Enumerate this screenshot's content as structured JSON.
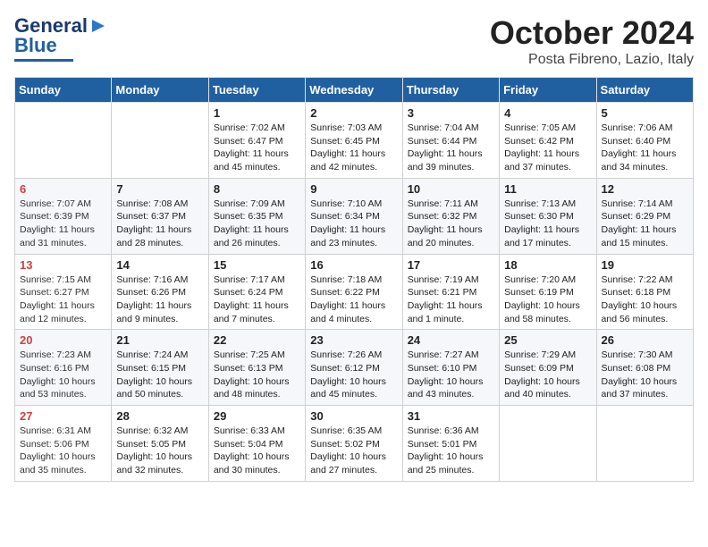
{
  "header": {
    "logo_line1": "General",
    "logo_line2": "Blue",
    "title": "October 2024",
    "subtitle": "Posta Fibreno, Lazio, Italy"
  },
  "days_of_week": [
    "Sunday",
    "Monday",
    "Tuesday",
    "Wednesday",
    "Thursday",
    "Friday",
    "Saturday"
  ],
  "weeks": [
    [
      {
        "day": "",
        "info": ""
      },
      {
        "day": "",
        "info": ""
      },
      {
        "day": "1",
        "info": "Sunrise: 7:02 AM\nSunset: 6:47 PM\nDaylight: 11 hours and 45 minutes."
      },
      {
        "day": "2",
        "info": "Sunrise: 7:03 AM\nSunset: 6:45 PM\nDaylight: 11 hours and 42 minutes."
      },
      {
        "day": "3",
        "info": "Sunrise: 7:04 AM\nSunset: 6:44 PM\nDaylight: 11 hours and 39 minutes."
      },
      {
        "day": "4",
        "info": "Sunrise: 7:05 AM\nSunset: 6:42 PM\nDaylight: 11 hours and 37 minutes."
      },
      {
        "day": "5",
        "info": "Sunrise: 7:06 AM\nSunset: 6:40 PM\nDaylight: 11 hours and 34 minutes."
      }
    ],
    [
      {
        "day": "6",
        "info": "Sunrise: 7:07 AM\nSunset: 6:39 PM\nDaylight: 11 hours and 31 minutes."
      },
      {
        "day": "7",
        "info": "Sunrise: 7:08 AM\nSunset: 6:37 PM\nDaylight: 11 hours and 28 minutes."
      },
      {
        "day": "8",
        "info": "Sunrise: 7:09 AM\nSunset: 6:35 PM\nDaylight: 11 hours and 26 minutes."
      },
      {
        "day": "9",
        "info": "Sunrise: 7:10 AM\nSunset: 6:34 PM\nDaylight: 11 hours and 23 minutes."
      },
      {
        "day": "10",
        "info": "Sunrise: 7:11 AM\nSunset: 6:32 PM\nDaylight: 11 hours and 20 minutes."
      },
      {
        "day": "11",
        "info": "Sunrise: 7:13 AM\nSunset: 6:30 PM\nDaylight: 11 hours and 17 minutes."
      },
      {
        "day": "12",
        "info": "Sunrise: 7:14 AM\nSunset: 6:29 PM\nDaylight: 11 hours and 15 minutes."
      }
    ],
    [
      {
        "day": "13",
        "info": "Sunrise: 7:15 AM\nSunset: 6:27 PM\nDaylight: 11 hours and 12 minutes."
      },
      {
        "day": "14",
        "info": "Sunrise: 7:16 AM\nSunset: 6:26 PM\nDaylight: 11 hours and 9 minutes."
      },
      {
        "day": "15",
        "info": "Sunrise: 7:17 AM\nSunset: 6:24 PM\nDaylight: 11 hours and 7 minutes."
      },
      {
        "day": "16",
        "info": "Sunrise: 7:18 AM\nSunset: 6:22 PM\nDaylight: 11 hours and 4 minutes."
      },
      {
        "day": "17",
        "info": "Sunrise: 7:19 AM\nSunset: 6:21 PM\nDaylight: 11 hours and 1 minute."
      },
      {
        "day": "18",
        "info": "Sunrise: 7:20 AM\nSunset: 6:19 PM\nDaylight: 10 hours and 58 minutes."
      },
      {
        "day": "19",
        "info": "Sunrise: 7:22 AM\nSunset: 6:18 PM\nDaylight: 10 hours and 56 minutes."
      }
    ],
    [
      {
        "day": "20",
        "info": "Sunrise: 7:23 AM\nSunset: 6:16 PM\nDaylight: 10 hours and 53 minutes."
      },
      {
        "day": "21",
        "info": "Sunrise: 7:24 AM\nSunset: 6:15 PM\nDaylight: 10 hours and 50 minutes."
      },
      {
        "day": "22",
        "info": "Sunrise: 7:25 AM\nSunset: 6:13 PM\nDaylight: 10 hours and 48 minutes."
      },
      {
        "day": "23",
        "info": "Sunrise: 7:26 AM\nSunset: 6:12 PM\nDaylight: 10 hours and 45 minutes."
      },
      {
        "day": "24",
        "info": "Sunrise: 7:27 AM\nSunset: 6:10 PM\nDaylight: 10 hours and 43 minutes."
      },
      {
        "day": "25",
        "info": "Sunrise: 7:29 AM\nSunset: 6:09 PM\nDaylight: 10 hours and 40 minutes."
      },
      {
        "day": "26",
        "info": "Sunrise: 7:30 AM\nSunset: 6:08 PM\nDaylight: 10 hours and 37 minutes."
      }
    ],
    [
      {
        "day": "27",
        "info": "Sunrise: 6:31 AM\nSunset: 5:06 PM\nDaylight: 10 hours and 35 minutes."
      },
      {
        "day": "28",
        "info": "Sunrise: 6:32 AM\nSunset: 5:05 PM\nDaylight: 10 hours and 32 minutes."
      },
      {
        "day": "29",
        "info": "Sunrise: 6:33 AM\nSunset: 5:04 PM\nDaylight: 10 hours and 30 minutes."
      },
      {
        "day": "30",
        "info": "Sunrise: 6:35 AM\nSunset: 5:02 PM\nDaylight: 10 hours and 27 minutes."
      },
      {
        "day": "31",
        "info": "Sunrise: 6:36 AM\nSunset: 5:01 PM\nDaylight: 10 hours and 25 minutes."
      },
      {
        "day": "",
        "info": ""
      },
      {
        "day": "",
        "info": ""
      }
    ]
  ]
}
